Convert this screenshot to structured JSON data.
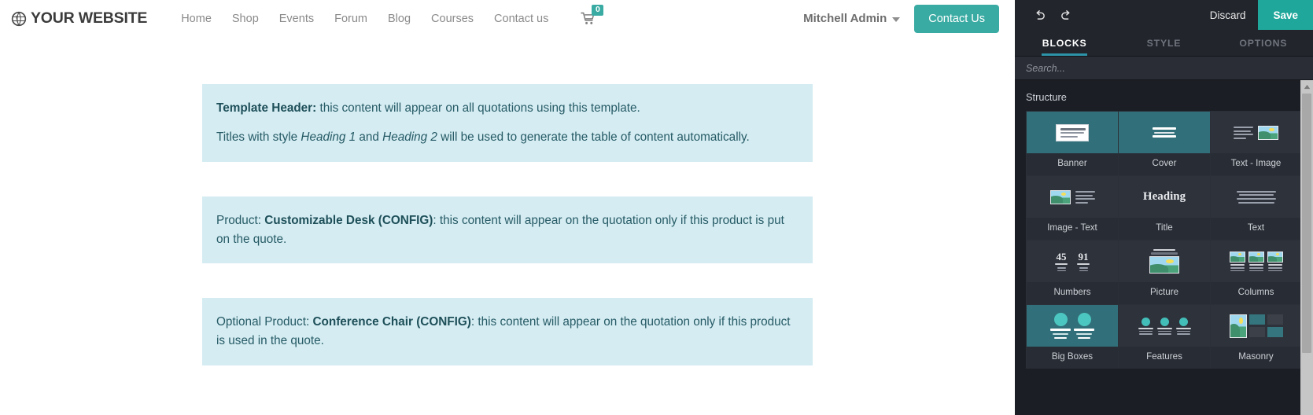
{
  "website": {
    "brand": "YOUR WEBSITE",
    "nav_links": [
      "Home",
      "Shop",
      "Events",
      "Forum",
      "Blog",
      "Courses",
      "Contact us"
    ],
    "cart_count": "0",
    "user_name": "Mitchell Admin",
    "contact_button": "Contact Us"
  },
  "content": {
    "alerts": [
      {
        "lines": [
          {
            "parts": [
              {
                "t": "Template Header:",
                "s": "b"
              },
              {
                "t": " this content will appear on all quotations using this template.",
                "s": "n"
              }
            ]
          },
          {
            "parts": [
              {
                "t": "Titles with style ",
                "s": "n"
              },
              {
                "t": "Heading 1",
                "s": "i"
              },
              {
                "t": " and ",
                "s": "n"
              },
              {
                "t": "Heading 2",
                "s": "i"
              },
              {
                "t": " will be used to generate the table of content automatically.",
                "s": "n"
              }
            ]
          }
        ]
      },
      {
        "lines": [
          {
            "parts": [
              {
                "t": "Product: ",
                "s": "n"
              },
              {
                "t": "Customizable Desk (CONFIG)",
                "s": "b"
              },
              {
                "t": ": this content will appear on the quotation only if this product is put on the quote.",
                "s": "n"
              }
            ]
          }
        ]
      },
      {
        "lines": [
          {
            "parts": [
              {
                "t": "Optional Product: ",
                "s": "n"
              },
              {
                "t": "Conference Chair (CONFIG)",
                "s": "b"
              },
              {
                "t": ": this content will appear on the quotation only if this product is used in the quote.",
                "s": "n"
              }
            ]
          }
        ]
      }
    ]
  },
  "editor": {
    "undo_icon": "undo-icon",
    "redo_icon": "redo-icon",
    "discard_label": "Discard",
    "save_label": "Save",
    "tabs": [
      {
        "label": "BLOCKS",
        "active": true
      },
      {
        "label": "STYLE",
        "active": false
      },
      {
        "label": "OPTIONS",
        "active": false
      }
    ],
    "search_placeholder": "Search...",
    "search_value": "",
    "section_title": "Structure",
    "blocks": [
      {
        "label": "Banner",
        "thumb": "banner",
        "highlight": true
      },
      {
        "label": "Cover",
        "thumb": "cover",
        "highlight": true
      },
      {
        "label": "Text - Image",
        "thumb": "text-image",
        "highlight": false
      },
      {
        "label": "Image - Text",
        "thumb": "image-text",
        "highlight": false
      },
      {
        "label": "Title",
        "thumb": "title",
        "highlight": false
      },
      {
        "label": "Text",
        "thumb": "text",
        "highlight": false
      },
      {
        "label": "Numbers",
        "thumb": "numbers",
        "highlight": false
      },
      {
        "label": "Picture",
        "thumb": "picture",
        "highlight": false
      },
      {
        "label": "Columns",
        "thumb": "columns",
        "highlight": false
      },
      {
        "label": "Big Boxes",
        "thumb": "big-boxes",
        "highlight": true
      },
      {
        "label": "Features",
        "thumb": "features",
        "highlight": false
      },
      {
        "label": "Masonry",
        "thumb": "masonry",
        "highlight": false
      }
    ],
    "numbers_values": [
      "45",
      "91"
    ],
    "title_thumb_text": "Heading"
  },
  "colors": {
    "accent_teal": "#3aaba3",
    "save_teal": "#20a79b",
    "alert_bg": "#d4ecf2",
    "alert_text": "#275b66",
    "panel_bg": "#1f2229",
    "tab_underline": "#2d93a8"
  }
}
